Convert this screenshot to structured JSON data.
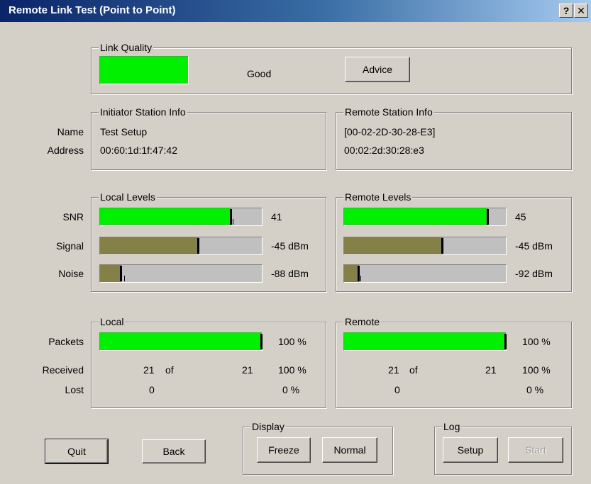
{
  "window": {
    "title": "Remote Link Test (Point to Point)",
    "help_glyph": "?",
    "close_glyph": "✕"
  },
  "colors": {
    "good": "#00f000",
    "signal": "#858047",
    "trough": "#c0c0c0",
    "titlebar": "#0a246a"
  },
  "link_quality": {
    "group_label": "Link Quality",
    "status": "Good",
    "advice_label": "Advice"
  },
  "row_labels": {
    "name": "Name",
    "address": "Address",
    "snr": "SNR",
    "signal": "Signal",
    "noise": "Noise",
    "packets": "Packets",
    "received": "Received",
    "lost": "Lost"
  },
  "initiator": {
    "group_label": "Initiator Station Info",
    "name": "Test Setup",
    "address": "00:60:1d:1f:47:42"
  },
  "remote_station": {
    "group_label": "Remote Station Info",
    "name": "[00-02-2D-30-28-E3]",
    "address": "00:02:2d:30:28:e3"
  },
  "local_levels": {
    "group_label": "Local Levels",
    "snr": {
      "value": "41",
      "fill": 0.81,
      "peak": 0.83
    },
    "signal": {
      "value": "-45 dBm",
      "fill": 0.61
    },
    "noise": {
      "value": "-88 dBm",
      "fill": 0.13,
      "peak": 0.16
    }
  },
  "remote_levels": {
    "group_label": "Remote Levels",
    "snr": {
      "value": "45",
      "fill": 0.89
    },
    "signal": {
      "value": "-45 dBm",
      "fill": 0.61
    },
    "noise": {
      "value": "-92 dBm",
      "fill": 0.09,
      "peak": 0.11
    }
  },
  "local_packets": {
    "group_label": "Local",
    "fill": 1.0,
    "packets_pct": "100 %",
    "received": "21",
    "of": "of",
    "total": "21",
    "received_pct": "100 %",
    "lost": "0",
    "lost_pct": "0 %"
  },
  "remote_packets": {
    "group_label": "Remote",
    "fill": 1.0,
    "packets_pct": "100 %",
    "received": "21",
    "of": "of",
    "total": "21",
    "received_pct": "100 %",
    "lost": "0",
    "lost_pct": "0 %"
  },
  "buttons": {
    "quit": "Quit",
    "back": "Back"
  },
  "display": {
    "group_label": "Display",
    "freeze": "Freeze",
    "normal": "Normal"
  },
  "log": {
    "group_label": "Log",
    "setup": "Setup",
    "start": "Start"
  }
}
